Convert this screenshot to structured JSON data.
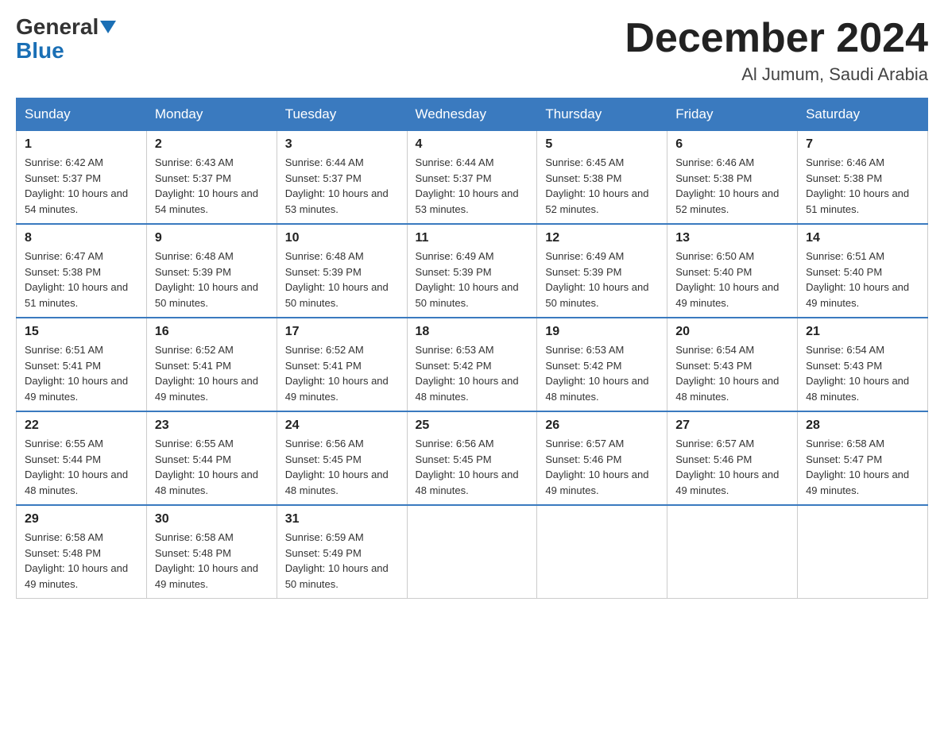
{
  "logo": {
    "general": "General",
    "blue": "Blue"
  },
  "header": {
    "month": "December 2024",
    "location": "Al Jumum, Saudi Arabia"
  },
  "days_of_week": [
    "Sunday",
    "Monday",
    "Tuesday",
    "Wednesday",
    "Thursday",
    "Friday",
    "Saturday"
  ],
  "weeks": [
    [
      {
        "day": "1",
        "sunrise": "6:42 AM",
        "sunset": "5:37 PM",
        "daylight": "10 hours and 54 minutes."
      },
      {
        "day": "2",
        "sunrise": "6:43 AM",
        "sunset": "5:37 PM",
        "daylight": "10 hours and 54 minutes."
      },
      {
        "day": "3",
        "sunrise": "6:44 AM",
        "sunset": "5:37 PM",
        "daylight": "10 hours and 53 minutes."
      },
      {
        "day": "4",
        "sunrise": "6:44 AM",
        "sunset": "5:37 PM",
        "daylight": "10 hours and 53 minutes."
      },
      {
        "day": "5",
        "sunrise": "6:45 AM",
        "sunset": "5:38 PM",
        "daylight": "10 hours and 52 minutes."
      },
      {
        "day": "6",
        "sunrise": "6:46 AM",
        "sunset": "5:38 PM",
        "daylight": "10 hours and 52 minutes."
      },
      {
        "day": "7",
        "sunrise": "6:46 AM",
        "sunset": "5:38 PM",
        "daylight": "10 hours and 51 minutes."
      }
    ],
    [
      {
        "day": "8",
        "sunrise": "6:47 AM",
        "sunset": "5:38 PM",
        "daylight": "10 hours and 51 minutes."
      },
      {
        "day": "9",
        "sunrise": "6:48 AM",
        "sunset": "5:39 PM",
        "daylight": "10 hours and 50 minutes."
      },
      {
        "day": "10",
        "sunrise": "6:48 AM",
        "sunset": "5:39 PM",
        "daylight": "10 hours and 50 minutes."
      },
      {
        "day": "11",
        "sunrise": "6:49 AM",
        "sunset": "5:39 PM",
        "daylight": "10 hours and 50 minutes."
      },
      {
        "day": "12",
        "sunrise": "6:49 AM",
        "sunset": "5:39 PM",
        "daylight": "10 hours and 50 minutes."
      },
      {
        "day": "13",
        "sunrise": "6:50 AM",
        "sunset": "5:40 PM",
        "daylight": "10 hours and 49 minutes."
      },
      {
        "day": "14",
        "sunrise": "6:51 AM",
        "sunset": "5:40 PM",
        "daylight": "10 hours and 49 minutes."
      }
    ],
    [
      {
        "day": "15",
        "sunrise": "6:51 AM",
        "sunset": "5:41 PM",
        "daylight": "10 hours and 49 minutes."
      },
      {
        "day": "16",
        "sunrise": "6:52 AM",
        "sunset": "5:41 PM",
        "daylight": "10 hours and 49 minutes."
      },
      {
        "day": "17",
        "sunrise": "6:52 AM",
        "sunset": "5:41 PM",
        "daylight": "10 hours and 49 minutes."
      },
      {
        "day": "18",
        "sunrise": "6:53 AM",
        "sunset": "5:42 PM",
        "daylight": "10 hours and 48 minutes."
      },
      {
        "day": "19",
        "sunrise": "6:53 AM",
        "sunset": "5:42 PM",
        "daylight": "10 hours and 48 minutes."
      },
      {
        "day": "20",
        "sunrise": "6:54 AM",
        "sunset": "5:43 PM",
        "daylight": "10 hours and 48 minutes."
      },
      {
        "day": "21",
        "sunrise": "6:54 AM",
        "sunset": "5:43 PM",
        "daylight": "10 hours and 48 minutes."
      }
    ],
    [
      {
        "day": "22",
        "sunrise": "6:55 AM",
        "sunset": "5:44 PM",
        "daylight": "10 hours and 48 minutes."
      },
      {
        "day": "23",
        "sunrise": "6:55 AM",
        "sunset": "5:44 PM",
        "daylight": "10 hours and 48 minutes."
      },
      {
        "day": "24",
        "sunrise": "6:56 AM",
        "sunset": "5:45 PM",
        "daylight": "10 hours and 48 minutes."
      },
      {
        "day": "25",
        "sunrise": "6:56 AM",
        "sunset": "5:45 PM",
        "daylight": "10 hours and 48 minutes."
      },
      {
        "day": "26",
        "sunrise": "6:57 AM",
        "sunset": "5:46 PM",
        "daylight": "10 hours and 49 minutes."
      },
      {
        "day": "27",
        "sunrise": "6:57 AM",
        "sunset": "5:46 PM",
        "daylight": "10 hours and 49 minutes."
      },
      {
        "day": "28",
        "sunrise": "6:58 AM",
        "sunset": "5:47 PM",
        "daylight": "10 hours and 49 minutes."
      }
    ],
    [
      {
        "day": "29",
        "sunrise": "6:58 AM",
        "sunset": "5:48 PM",
        "daylight": "10 hours and 49 minutes."
      },
      {
        "day": "30",
        "sunrise": "6:58 AM",
        "sunset": "5:48 PM",
        "daylight": "10 hours and 49 minutes."
      },
      {
        "day": "31",
        "sunrise": "6:59 AM",
        "sunset": "5:49 PM",
        "daylight": "10 hours and 50 minutes."
      },
      null,
      null,
      null,
      null
    ]
  ]
}
